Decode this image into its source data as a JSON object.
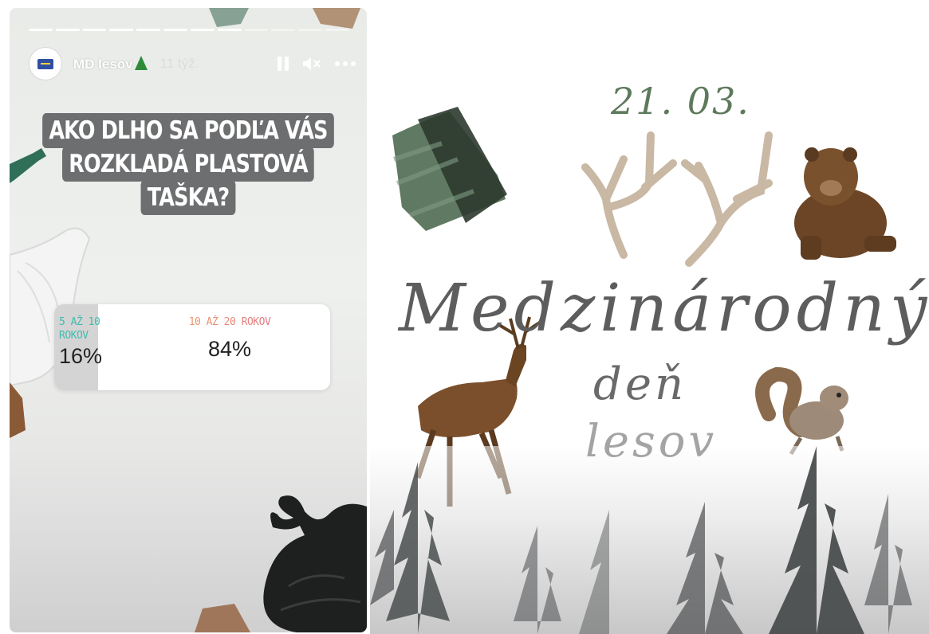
{
  "story": {
    "author": "MD lesov",
    "time": "11 týž.",
    "progress": {
      "segments": 12,
      "completed": 8
    },
    "question_lines": [
      "AKO DLHO SA PODĽA VÁS",
      "ROZKLADÁ PLASTOVÁ",
      "TAŠKA?"
    ],
    "poll": {
      "options": [
        {
          "label_lines": [
            "5 AŽ 10",
            "ROKOV"
          ],
          "percent": "16%",
          "share": 16
        },
        {
          "label_lines": [
            "10 AŽ 20 ROKOV"
          ],
          "percent": "84%",
          "share": 84
        }
      ]
    },
    "icons": [
      "tree-icon",
      "pause-icon",
      "mute-icon",
      "more-icon"
    ]
  },
  "poster": {
    "date": "21. 03.",
    "title": [
      "Medzinárodný",
      "deň",
      "lesov"
    ],
    "colors": {
      "date": "#5d7a5c",
      "title_dark": "#5d5d5d",
      "title_light": "#a4a4a4"
    }
  }
}
